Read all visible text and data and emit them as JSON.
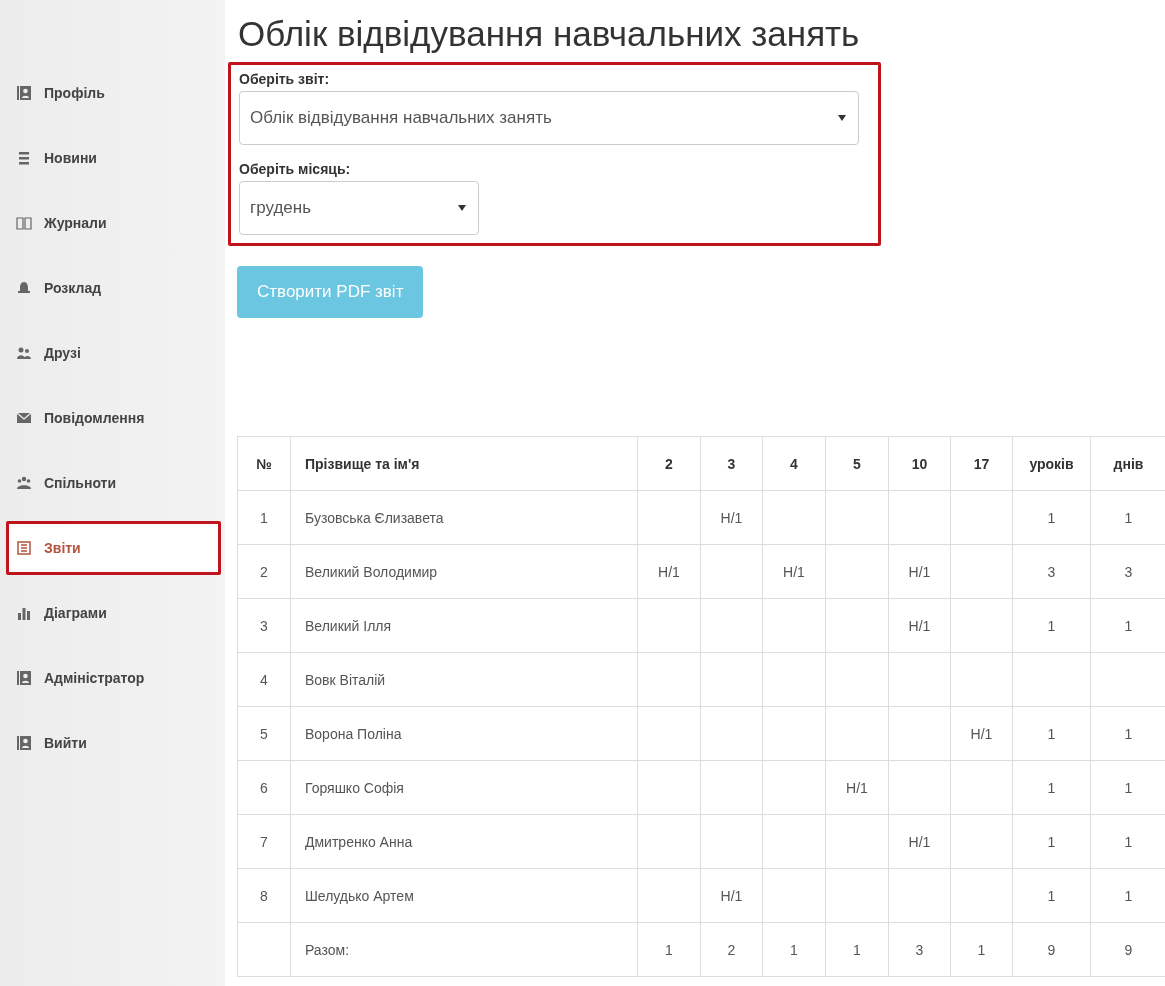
{
  "sidebar": {
    "items": [
      {
        "label": "Профіль",
        "kind": "contact",
        "selected": false,
        "highlighted": false
      },
      {
        "label": "Новини",
        "kind": "lines",
        "selected": false,
        "highlighted": false
      },
      {
        "label": "Журнали",
        "kind": "book",
        "selected": false,
        "highlighted": false
      },
      {
        "label": "Розклад",
        "kind": "bell",
        "selected": false,
        "highlighted": false
      },
      {
        "label": "Друзі",
        "kind": "people",
        "selected": false,
        "highlighted": false
      },
      {
        "label": "Повідомлення",
        "kind": "mail",
        "selected": false,
        "highlighted": false
      },
      {
        "label": "Спільноти",
        "kind": "group",
        "selected": false,
        "highlighted": false
      },
      {
        "label": "Звіти",
        "kind": "list",
        "selected": true,
        "highlighted": true
      },
      {
        "label": "Діаграми",
        "kind": "chart",
        "selected": false,
        "highlighted": false
      },
      {
        "label": "Адміністратор",
        "kind": "contact",
        "selected": false,
        "highlighted": false
      },
      {
        "label": "Вийти",
        "kind": "contact",
        "selected": false,
        "highlighted": false
      }
    ]
  },
  "title": "Облік відвідування навчальних занять",
  "form": {
    "highlighted": true,
    "report": {
      "label": "Оберіть звіт:",
      "value": "Облік відвідування навчальних занять"
    },
    "month": {
      "label": "Оберіть місяць:",
      "value": "грудень"
    },
    "button": "Створити PDF звіт"
  },
  "table": {
    "columns": [
      "№",
      "Прізвище та ім'я",
      "2",
      "3",
      "4",
      "5",
      "10",
      "17",
      "уроків",
      "днів"
    ],
    "rows": [
      [
        "1",
        "Бузовська Єлизавета",
        "",
        "Н/1",
        "",
        "",
        "",
        "",
        "1",
        "1"
      ],
      [
        "2",
        "Великий Володимир",
        "Н/1",
        "",
        "Н/1",
        "",
        "Н/1",
        "",
        "3",
        "3"
      ],
      [
        "3",
        "Великий Ілля",
        "",
        "",
        "",
        "",
        "Н/1",
        "",
        "1",
        "1"
      ],
      [
        "4",
        "Вовк Віталій",
        "",
        "",
        "",
        "",
        "",
        "",
        "",
        ""
      ],
      [
        "5",
        "Ворона Поліна",
        "",
        "",
        "",
        "",
        "",
        "Н/1",
        "1",
        "1"
      ],
      [
        "6",
        "Горяшко Софія",
        "",
        "",
        "",
        "Н/1",
        "",
        "",
        "1",
        "1"
      ],
      [
        "7",
        "Дмитренко Анна",
        "",
        "",
        "",
        "",
        "Н/1",
        "",
        "1",
        "1"
      ],
      [
        "8",
        "Шелудько Артем",
        "",
        "Н/1",
        "",
        "",
        "",
        "",
        "1",
        "1"
      ],
      [
        "",
        "Разом:",
        "1",
        "2",
        "1",
        "1",
        "3",
        "1",
        "9",
        "9"
      ]
    ]
  }
}
